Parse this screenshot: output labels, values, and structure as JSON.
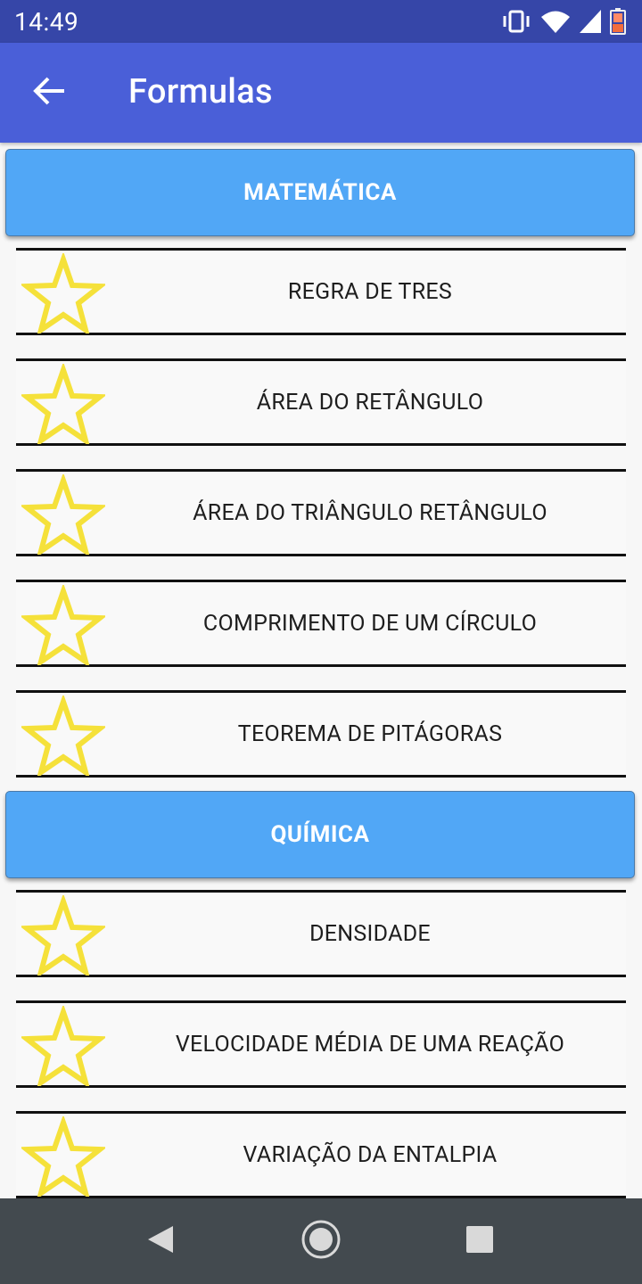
{
  "status_bar": {
    "time": "14:49",
    "icons": [
      "vibrate-icon",
      "wifi-icon",
      "signal-icon",
      "battery-icon"
    ]
  },
  "app_bar": {
    "title": "Formulas",
    "back_icon": "arrow-left-icon"
  },
  "sections": [
    {
      "title": "MATEMÁTICA",
      "items": [
        "REGRA DE TRES",
        "ÁREA DO RETÂNGULO",
        "ÁREA DO TRIÂNGULO RETÂNGULO",
        "COMPRIMENTO DE UM CÍRCULO",
        "TEOREMA DE PITÁGORAS"
      ]
    },
    {
      "title": "QUÍMICA",
      "items": [
        "DENSIDADE",
        "VELOCIDADE MÉDIA DE UMA REAÇÃO",
        "VARIAÇÃO DA ENTALPIA"
      ]
    }
  ],
  "colors": {
    "status_bar": "#3646a8",
    "app_bar": "#4a5fd8",
    "section_header": "#51a7f6",
    "star": "#f5e13a",
    "nav_bar": "#434a4f"
  },
  "nav_bar": {
    "buttons": [
      "back-triangle-icon",
      "home-circle-icon",
      "recents-square-icon"
    ]
  }
}
